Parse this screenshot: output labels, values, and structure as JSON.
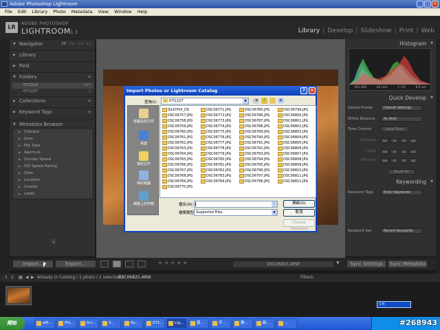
{
  "window": {
    "title": "Adobe Photoshop Lightroom",
    "buttons": [
      "_",
      "□",
      "×"
    ]
  },
  "menubar": [
    "File",
    "Edit",
    "Library",
    "Photo",
    "Metadata",
    "View",
    "Window",
    "Help"
  ],
  "identity": {
    "logo": "LR",
    "brand_small": "ADOBE PHOTOSHOP",
    "brand_large": "LIGHTROOM",
    "version": "1.3",
    "modules": [
      "Library",
      "Develop",
      "Slideshow",
      "Print",
      "Web"
    ],
    "active_module": "Library",
    "separator": "|"
  },
  "left_panel": {
    "navigator": "Navigator",
    "navigator_options": [
      "FIT",
      "FILL",
      "1:1",
      "3:1"
    ],
    "library": "Library",
    "find": "Find",
    "folders": "Folders",
    "folder_items": [
      {
        "name": "071210",
        "count": "147"
      },
      {
        "name": "071227",
        "count": "1"
      }
    ],
    "collections": "Collections",
    "keyword_tags": "Keyword Tags",
    "metadata_browser": "Metadata Browser",
    "metadata_items": [
      "Camera",
      "Lens",
      "File Type",
      "Aperture",
      "Shutter Speed",
      "ISO Speed Rating",
      "Date",
      "Location",
      "Creator",
      "Label"
    ],
    "plus": "+"
  },
  "right_panel": {
    "histogram": "Histogram",
    "histo_info": [
      "ISO 200",
      "20 mm",
      "f / 10",
      "8.0 sec"
    ],
    "quick_develop": "Quick Develop",
    "saved_preset_label": "Saved Preset",
    "saved_preset_value": "Default Settings",
    "white_balance_label": "White Balance",
    "white_balance_value": "As Shot",
    "tone_control_label": "Tone Control",
    "auto_tone": "Auto Tone",
    "exposure": "Exposure",
    "clarity": "Clarity",
    "vibrance": "Vibrance",
    "reset_all": "Reset All",
    "keywording": "Keywording",
    "keyword_tags_label": "Keyword Tags",
    "keyword_tags_value": "Enter Keywords",
    "keyword_set_label": "Keyword Set",
    "keyword_set_value": "Recent Keywords"
  },
  "toolbar": {
    "import": "Import...",
    "export": "Export...",
    "stars": "★★★★★",
    "filename": "DSC06825.ARW",
    "sync_settings": "Sync Settings",
    "sync_metadata": "Sync Metadata"
  },
  "filmbar": {
    "page1": "1",
    "page2": "2",
    "status": "Already In Catalog / 1 photo / 1 selected /",
    "filename": "DSC06825.ARW",
    "filters": "Filters:"
  },
  "dialog": {
    "title": "Import Photos or Lightroom Catalog",
    "help": "?",
    "close": "×",
    "look_in_label": "查詢(I):",
    "look_in_value": "071227",
    "places": [
      "我最近的文件",
      "桌面",
      "我的文件",
      "我的電腦",
      "網路上的芳鄰"
    ],
    "files": [
      [
        "SILKYPIX_DS",
        "DSC06757.JPG",
        "DSC06758.JPG",
        "DSC06759.JPG",
        "DSC06760.JPG",
        "DSC06761.JPG",
        "DSC06762.JPG",
        "DSC06763.JPG",
        "DSC06764.JPG",
        "DSC06765.JPG",
        "DSC06766.JPG",
        "DSC06767.JPG",
        "DSC06768.JPG",
        "DSC06769.JPG",
        "DSC06770.JPG"
      ],
      [
        "DSC06771.JPG",
        "DSC06772.JPG",
        "DSC06773.JPG",
        "DSC06774.JPG",
        "DSC06775.JPG",
        "DSC06776.JPG",
        "DSC06777.JPG",
        "DSC06778.JPG",
        "DSC06779.JPG",
        "DSC06780.JPG",
        "DSC06781.JPG",
        "DSC06782.JPG",
        "DSC06783.JPG",
        "DSC06784.JPG"
      ],
      [
        "DSC06785.JPG",
        "DSC06786.JPG",
        "DSC06787.JPG",
        "DSC06788.JPG",
        "DSC06789.JPG",
        "DSC06790.JPG",
        "DSC06791.JPG",
        "DSC06792.JPG",
        "DSC06793.JPG",
        "DSC06794.JPG",
        "DSC06795.JPG",
        "DSC06796.JPG",
        "DSC06797.JPG",
        "DSC06798.JPG"
      ],
      [
        "DSC06799.JPG",
        "DSC06800.JPG",
        "DSC06801.JPG",
        "DSC06802.JPG",
        "DSC06803.JPG",
        "DSC06804.JPG",
        "DSC06805.JPG",
        "DSC06806.JPG",
        "DSC06807.JPG",
        "DSC06808.JPG",
        "DSC06809.JPG",
        "DSC06810.JPG",
        "DSC06811.JPG",
        "DSC06812.JPG"
      ]
    ],
    "file_name_label": "檔名(N):",
    "file_type_label": "檔案類型(T):",
    "file_type_value": "Supported Files",
    "open_button": "開啟(O)",
    "cancel_button": "取消",
    "choose_selected": "Choose Selected"
  },
  "filmstrip_ime": "CH",
  "taskbar": {
    "start": "開始",
    "tasks": [
      "aM...",
      "Phi...",
      "Scr...",
      "3...",
      "Ry...",
      "071...",
      "Lig...",
      "駕...",
      "不...",
      "静...",
      "新...",
      "..."
    ],
    "active_index": 6,
    "watermark": "#268943"
  }
}
